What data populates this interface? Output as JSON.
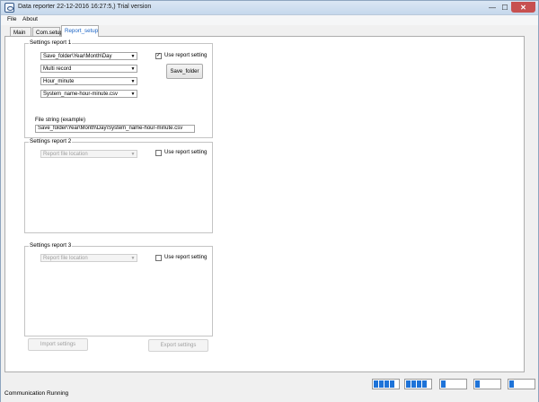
{
  "window": {
    "title": "Data reporter 22-12-2016 16:27:5,) Trial version",
    "controls": {
      "minimize": "—",
      "maximize": "☐",
      "close": "✕"
    }
  },
  "menu": {
    "file": "File",
    "about": "About"
  },
  "tabs": [
    {
      "label": "Main"
    },
    {
      "label": "Com.setup"
    },
    {
      "label": "Report_setup",
      "active": true
    }
  ],
  "report1": {
    "title": "Settings report 1",
    "combos": [
      "Save_folder\\Year\\Month\\Day",
      "Multi record",
      "Hour_minute",
      "System_name-hour-minute.csv"
    ],
    "use_setting_label": "Use report setting",
    "use_setting_checked": true,
    "save_folder_button": "Save_folder",
    "file_string_label": "File string (example)",
    "file_string_value": "Save_folder\\Year\\Month\\Day\\System_name-hour-minute.csv"
  },
  "report2": {
    "title": "Settings report 2",
    "location_combo": "Report file location",
    "use_setting_label": "Use report setting",
    "use_setting_checked": false
  },
  "report3": {
    "title": "Settings report 3",
    "location_combo": "Report file location",
    "use_setting_label": "Use report setting",
    "use_setting_checked": false
  },
  "buttons": {
    "import": "Import settings",
    "export": "Export settings"
  },
  "status": {
    "text": "Communication Running",
    "meters": [
      {
        "filled": 4,
        "total": 4
      },
      {
        "filled": 4,
        "total": 4
      },
      {
        "filled": 1,
        "total": 4
      },
      {
        "filled": 1,
        "total": 4
      },
      {
        "filled": 1,
        "total": 4
      }
    ],
    "accent_color": "#1e73d8"
  },
  "icons": {
    "combo_arrow": "combo-arrow-icon",
    "check": "checkmark-icon"
  }
}
